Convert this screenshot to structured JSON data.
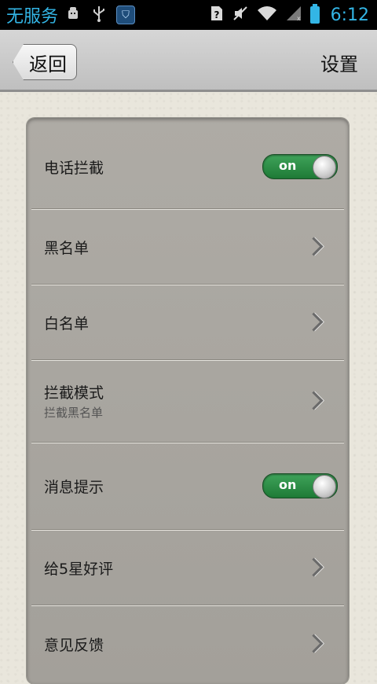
{
  "status_bar": {
    "carrier": "无服务",
    "time": "6:12",
    "icons_left": [
      "android-debug-icon",
      "usb-icon",
      "shield-app-icon"
    ],
    "icons_right": [
      "sim-unknown-icon",
      "mute-icon",
      "wifi-icon",
      "signal-icon",
      "battery-icon"
    ]
  },
  "title_bar": {
    "back_label": "返回",
    "title": "设置"
  },
  "settings": {
    "call_block": {
      "label": "电话拦截",
      "toggle": "on"
    },
    "blacklist": {
      "label": "黑名单"
    },
    "whitelist": {
      "label": "白名单"
    },
    "block_mode": {
      "label": "拦截模式",
      "sub": "拦截黑名单"
    },
    "notification": {
      "label": "消息提示",
      "toggle": "on"
    },
    "rate": {
      "label": "给5星好评"
    },
    "feedback": {
      "label": "意见反馈"
    }
  },
  "colors": {
    "accent": "#33b5e5",
    "toggle_on": "#2a8c44"
  }
}
